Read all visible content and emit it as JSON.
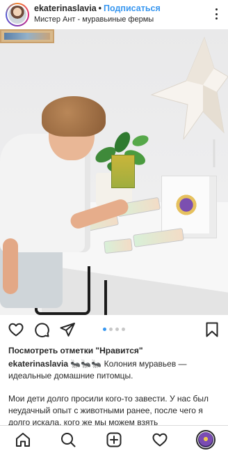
{
  "post": {
    "username": "ekaterinaslavia",
    "separator": "•",
    "follow_label": "Подписаться",
    "location": "Мистер Ант - муравьиные фермы"
  },
  "carousel": {
    "total": 4,
    "active": 1
  },
  "likes_text": "Посмотреть отметки \"Нравится\"",
  "caption": {
    "username": "ekaterinaslavia",
    "emoji": "🐜🐜🐜",
    "text": "Колония муравьев — идеальные домашние питомцы.",
    "paragraph2": "Мои дети долго просили кого-то завести. У нас был неудачный опыт с животными ранее, после чего я долго искала, кого же мы можем взять"
  },
  "icons": {
    "more": "more-vertical-icon",
    "like": "heart-icon",
    "comment": "comment-icon",
    "share": "send-icon",
    "save": "bookmark-icon",
    "home": "home-icon",
    "search": "search-icon",
    "new_post": "new-post-icon",
    "activity": "heart-icon"
  },
  "colors": {
    "accent": "#3897f0",
    "text": "#262626",
    "dot_inactive": "#c7c7c7"
  }
}
